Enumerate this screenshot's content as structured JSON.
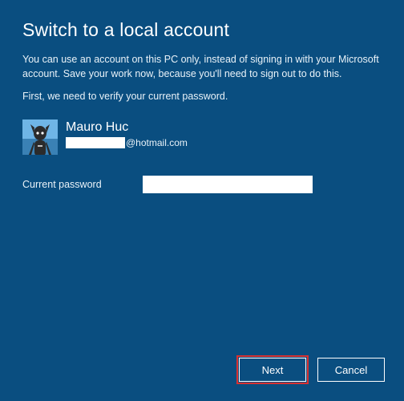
{
  "title": "Switch to a local account",
  "description": "You can use an account on this PC only, instead of signing in with your Microsoft account. Save your work now, because you'll need to sign out to do this.",
  "verify_text": "First, we need to verify your current password.",
  "user": {
    "name": "Mauro Huc",
    "email_domain": "@hotmail.com"
  },
  "password": {
    "label": "Current password",
    "value": ""
  },
  "buttons": {
    "next": "Next",
    "cancel": "Cancel"
  }
}
